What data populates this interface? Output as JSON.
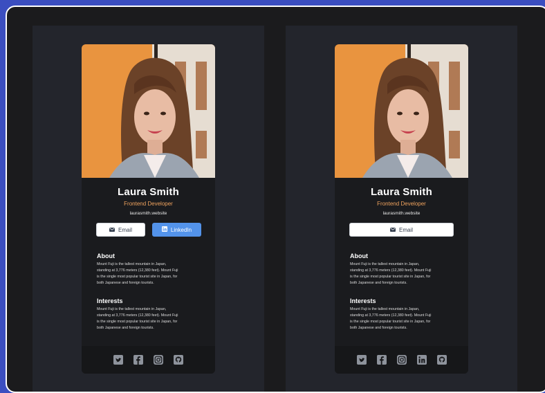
{
  "cards": [
    {
      "name": "Laura Smith",
      "role": "Frontend Developer",
      "website": "laurasmith.website",
      "buttons": {
        "email": "Email",
        "linkedin": "LinkedIn"
      },
      "about": {
        "title": "About",
        "lines": [
          "Mount Fuji is the tallest mountain in Japan,",
          "standing at 3,776 meters (12,380 feet). Mount Fuji",
          "is the single most popular tourist site in Japan, for",
          "both Japanese and foreign tourists."
        ]
      },
      "interests": {
        "title": "Interests",
        "lines": [
          "Mount Fuji is the tallest mountain in Japan,",
          "standing at 3,776 meters (12,380 feet). Mount Fuji",
          "is the single most popular tourist site in Japan, for",
          "both Japanese and foreign tourists."
        ]
      },
      "social_icons": [
        "twitter-icon",
        "facebook-icon",
        "instagram-icon",
        "github-icon"
      ]
    },
    {
      "name": "Laura Smith",
      "role": "Frontend Developer",
      "website": "laurasmith.website",
      "buttons": {
        "email": "Email"
      },
      "about": {
        "title": "About",
        "lines": [
          "Mount Fuji is the tallest mountain in Japan,",
          "standing at 3,776 meters (12,380 feet). Mount Fuji",
          "is the single most popular tourist site in Japan, for",
          "both Japanese and foreign tourists."
        ]
      },
      "interests": {
        "title": "Interests",
        "lines": [
          "Mount Fuji is the tallest mountain in Japan,",
          "standing at 3,776 meters (12,380 feet). Mount Fuji",
          "is the single most popular tourist site in Japan, for",
          "both Japanese and foreign tourists."
        ]
      },
      "social_icons": [
        "twitter-icon",
        "facebook-icon",
        "instagram-icon",
        "linkedin-icon",
        "github-icon"
      ]
    }
  ],
  "colors": {
    "accent": "#f0a35e",
    "linkedin_button": "#5393ea",
    "card_bg": "#1a1b1e",
    "panel_bg": "#23252c"
  }
}
